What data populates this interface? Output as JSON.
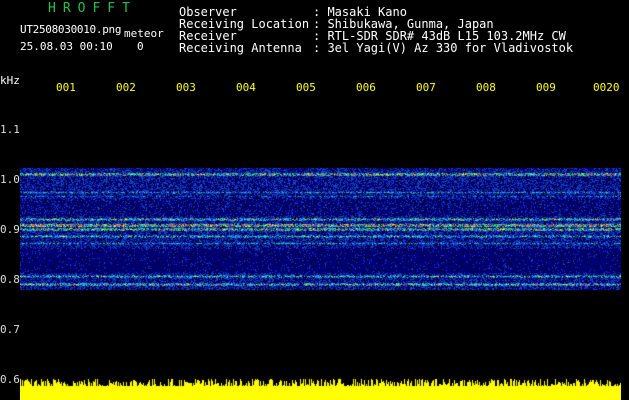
{
  "header": {
    "app_name": "HROFFT",
    "file_name": "UT2508030010.png",
    "mode": "meteor",
    "date_time": "25.08.03 00:10",
    "count": "0"
  },
  "info": [
    {
      "label": "Observer",
      "value": ": Masaki Kano"
    },
    {
      "label": "Receiving Location",
      "value": ": Shibukawa, Gunma, Japan"
    },
    {
      "label": "Receiver",
      "value": ": RTL-SDR SDR# 43dB L15 103.2MHz CW"
    },
    {
      "label": "Receiving Antenna",
      "value": ": 3el Yagi(V) Az 330 for Vladivostok"
    }
  ],
  "axis": {
    "y_unit": "kHz",
    "y_ticks": [
      "1.1",
      "1.0",
      "0.9",
      "0.8",
      "0.7",
      "0.6"
    ],
    "x_ticks": [
      "001",
      "002",
      "003",
      "004",
      "005",
      "006",
      "007",
      "008",
      "009",
      "0020"
    ]
  },
  "colors": {
    "background": "#000000",
    "title_green": "#21c24a",
    "tick_yellow": "#ffff00",
    "signal_base": "#00007a",
    "signal_line_red": "#ff3030"
  }
}
